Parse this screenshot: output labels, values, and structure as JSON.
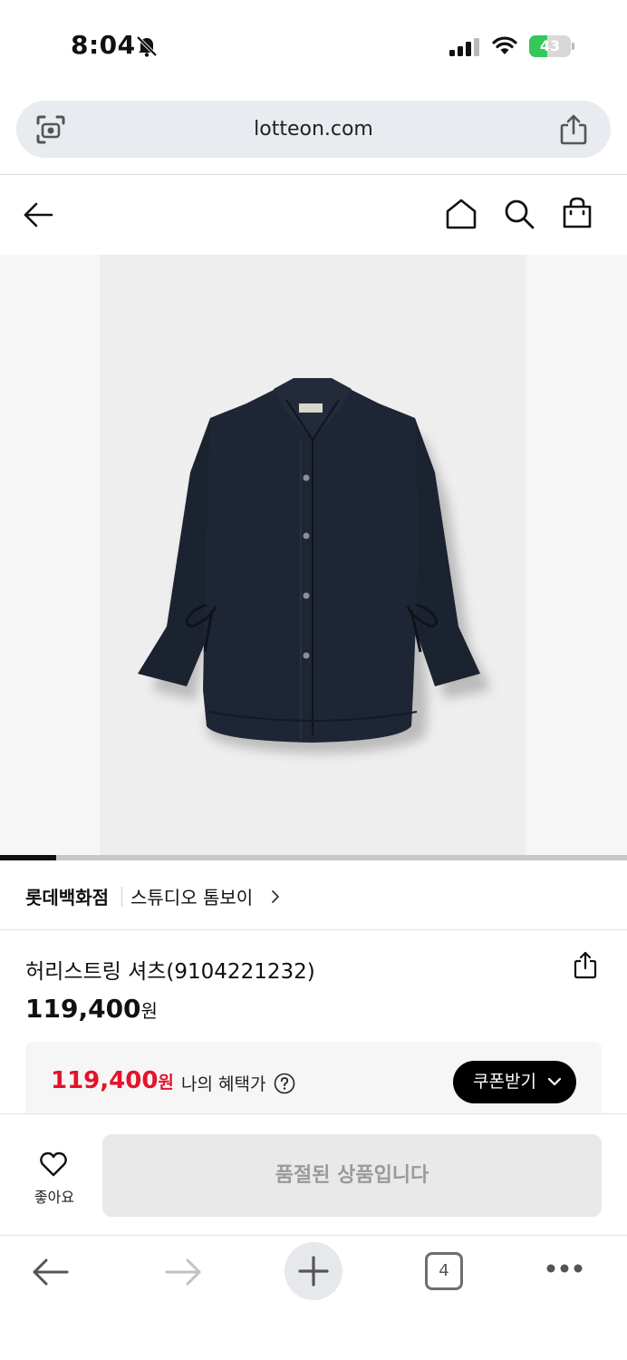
{
  "status": {
    "time": "8:04",
    "battery": "43",
    "battery_level": 0.43
  },
  "browser": {
    "url": "lotteon.com",
    "tab_count": "4"
  },
  "gallery": {
    "progress": 0.09
  },
  "brand": {
    "store": "롯데백화점",
    "name": "스튜디오 톰보이"
  },
  "product": {
    "title": "허리스트링 셔츠(9104221232)",
    "price": "119,400",
    "price_unit": "원"
  },
  "benefit": {
    "price": "119,400",
    "price_unit": "원",
    "label": "나의 혜택가",
    "coupon_label": "쿠폰받기"
  },
  "actions": {
    "like_label": "좋아요",
    "soldout_label": "품절된 상품입니다"
  },
  "colors": {
    "sale_red": "#e5132a",
    "battery_green": "#35c759"
  },
  "icons": [
    "bell-slash-icon",
    "signal-icon",
    "wifi-icon",
    "camera-search-icon",
    "share-icon",
    "back-arrow-icon",
    "home-icon",
    "search-icon",
    "shopping-bag-icon",
    "chevron-right-icon",
    "help-icon",
    "chevron-down-icon",
    "heart-icon",
    "forward-arrow-icon",
    "plus-icon",
    "more-icon"
  ]
}
